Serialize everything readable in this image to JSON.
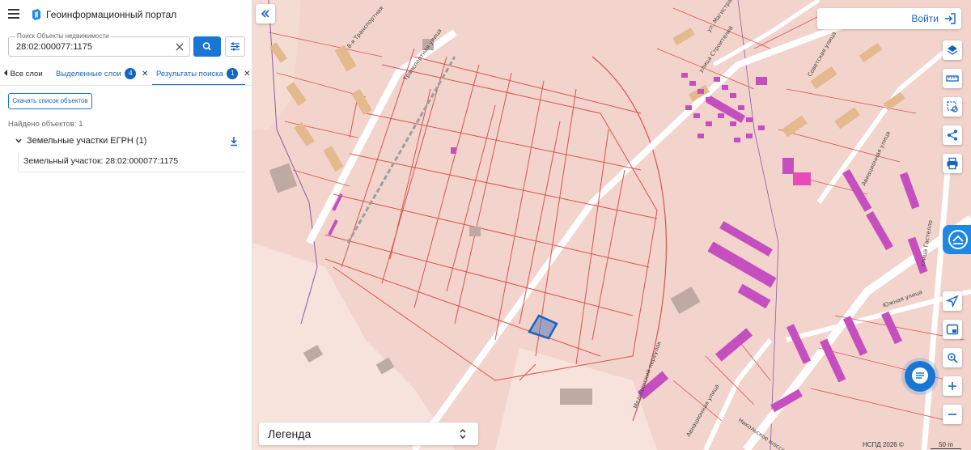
{
  "app": {
    "title": "Геоинформационный портал"
  },
  "search": {
    "label": "Поиск Объекты недвижимости",
    "value": "28:02:000077:1175"
  },
  "tabs": {
    "all_layers": "Все слои",
    "selected_layers": "Выделенные слои",
    "selected_count": "4",
    "search_results": "Результаты поиска",
    "results_count": "1"
  },
  "results": {
    "download_list": "Скачать список объектов",
    "found": "Найдено объектов: 1",
    "group_label": "Земельные участки ЕГРН (1)",
    "item_label": "Земельный участок: 28:02:000077:1175"
  },
  "map": {
    "login": "Войти",
    "legend": "Легенда",
    "attribution": "НСПД 2026 ©",
    "scale": "50 m",
    "streets": [
      "Транспортная улица",
      "улица Строителей",
      "Советская улица",
      "ул. Магистральная",
      "Авиационная улица",
      "улица Гастелло",
      "Южная улица",
      "Никольское шоссе",
      "Медицинский переулок",
      "Авиационная улица"
    ],
    "street_prefix": "8-я Транспортная",
    "colors": {
      "base": "#f2d4cc",
      "parcel_line": "#d9534f",
      "building": "#c64fc0",
      "selected_parcel": "#1565c0",
      "accent": "#1976d2"
    }
  },
  "icons": [
    "hamburger-icon",
    "logo-icon",
    "clear-icon",
    "search-icon",
    "filter-icon",
    "chevron-left-icon",
    "close-icon",
    "chevron-down-icon",
    "download-icon",
    "double-chevron-left-icon",
    "login-icon",
    "layers-icon",
    "ruler-icon",
    "select-area-icon",
    "share-icon",
    "print-icon",
    "locate-icon",
    "minimap-icon",
    "geo-search-icon",
    "zoom-in-icon",
    "zoom-out-icon",
    "chat-icon",
    "unfold-icon"
  ]
}
